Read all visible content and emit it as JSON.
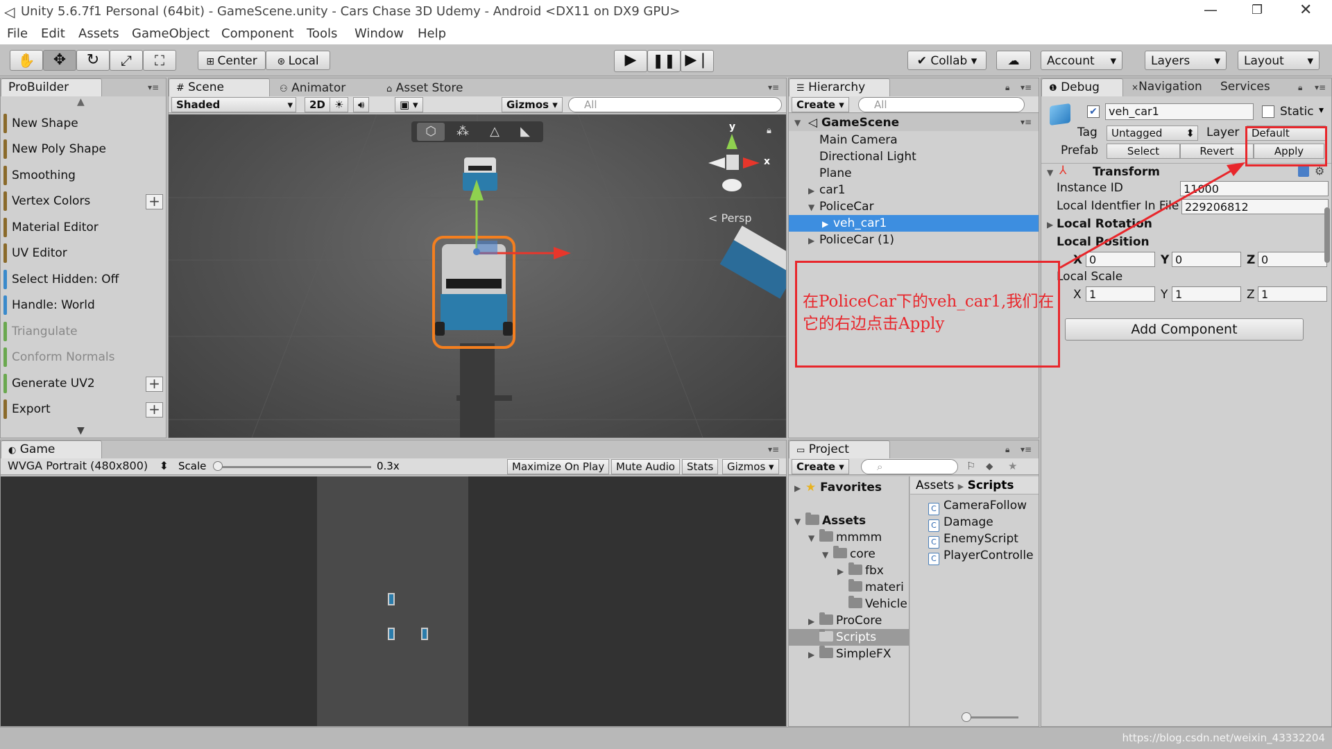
{
  "window": {
    "title": "Unity 5.6.7f1 Personal (64bit) - GameScene.unity - Cars Chase 3D Udemy - Android <DX11 on DX9 GPU>"
  },
  "menu": [
    "File",
    "Edit",
    "Assets",
    "GameObject",
    "Component",
    "Tools",
    "Window",
    "Help"
  ],
  "toolbar": {
    "center": "Center",
    "local": "Local",
    "collab": "Collab",
    "account": "Account",
    "layers": "Layers",
    "layout": "Layout"
  },
  "probuilder": {
    "tab": "ProBuilder",
    "items": [
      {
        "label": "New Shape",
        "color": "#8a6a2a"
      },
      {
        "label": "New Poly Shape",
        "color": "#8a6a2a"
      },
      {
        "label": "Smoothing",
        "color": "#8a6a2a"
      },
      {
        "label": "Vertex Colors",
        "color": "#8a6a2a"
      },
      {
        "label": "Material Editor",
        "color": "#8a6a2a"
      },
      {
        "label": "UV Editor",
        "color": "#8a6a2a"
      },
      {
        "label": "Select Hidden: Off",
        "color": "#3a8acb"
      },
      {
        "label": "Handle: World",
        "color": "#3a8acb"
      },
      {
        "label": "Triangulate",
        "color": "#6aa84f"
      },
      {
        "label": "Conform Normals",
        "color": "#6aa84f"
      },
      {
        "label": "Generate UV2",
        "color": "#6aa84f"
      },
      {
        "label": "Export",
        "color": "#8a6a2a"
      }
    ]
  },
  "scene": {
    "tabs": [
      "Scene",
      "Animator",
      "Asset Store"
    ],
    "shaded": "Shaded",
    "mode2d": "2D",
    "gizmos": "Gizmos",
    "search": "All",
    "persp": "Persp",
    "axis_y": "y",
    "axis_x": "x"
  },
  "game": {
    "tab": "Game",
    "resolution": "WVGA Portrait (480x800)",
    "scale_label": "Scale",
    "scale_value": "0.3x",
    "maximize": "Maximize On Play",
    "mute": "Mute Audio",
    "stats": "Stats",
    "gizmos": "Gizmos"
  },
  "hierarchy": {
    "tab": "Hierarchy",
    "create": "Create",
    "search": "All",
    "scene": "GameScene",
    "items": [
      "Main Camera",
      "Directional Light",
      "Plane",
      "car1",
      "PoliceCar",
      "veh_car1",
      "PoliceCar (1)"
    ]
  },
  "project": {
    "tab": "Project",
    "create": "Create",
    "favorites": "Favorites",
    "assets": "Assets",
    "tree": [
      "mmmm",
      "core",
      "fbx",
      "materi",
      "Vehicle",
      "ProCore",
      "Scripts",
      "SimpleFX"
    ],
    "breadcrumb_root": "Assets",
    "breadcrumb_current": "Scripts",
    "files": [
      "CameraFollow",
      "Damage",
      "EnemyScript",
      "PlayerControlle"
    ]
  },
  "inspector": {
    "tabs": [
      "Debug",
      "Navigation",
      "Services"
    ],
    "object_name": "veh_car1",
    "static": "Static",
    "tag_label": "Tag",
    "tag_value": "Untagged",
    "layer_label": "Layer",
    "layer_value": "Default",
    "prefab_label": "Prefab",
    "select": "Select",
    "revert": "Revert",
    "apply": "Apply",
    "transform": "Transform",
    "instance_id_label": "Instance ID",
    "instance_id": "11000",
    "local_id_label": "Local Identfier In File",
    "local_id": "229206812",
    "local_rotation": "Local Rotation",
    "local_position": "Local Position",
    "local_scale": "Local Scale",
    "pos": [
      "0",
      "0",
      "0"
    ],
    "scale": [
      "1",
      "1",
      "1"
    ],
    "x": "X",
    "y": "Y",
    "z": "Z",
    "add_component": "Add Component"
  },
  "annotation": {
    "text": "在PoliceCar下的veh_car1,我们在它的右边点击Apply",
    "color": "#e8262b"
  },
  "watermark": "https://blog.csdn.net/weixin_43332204"
}
